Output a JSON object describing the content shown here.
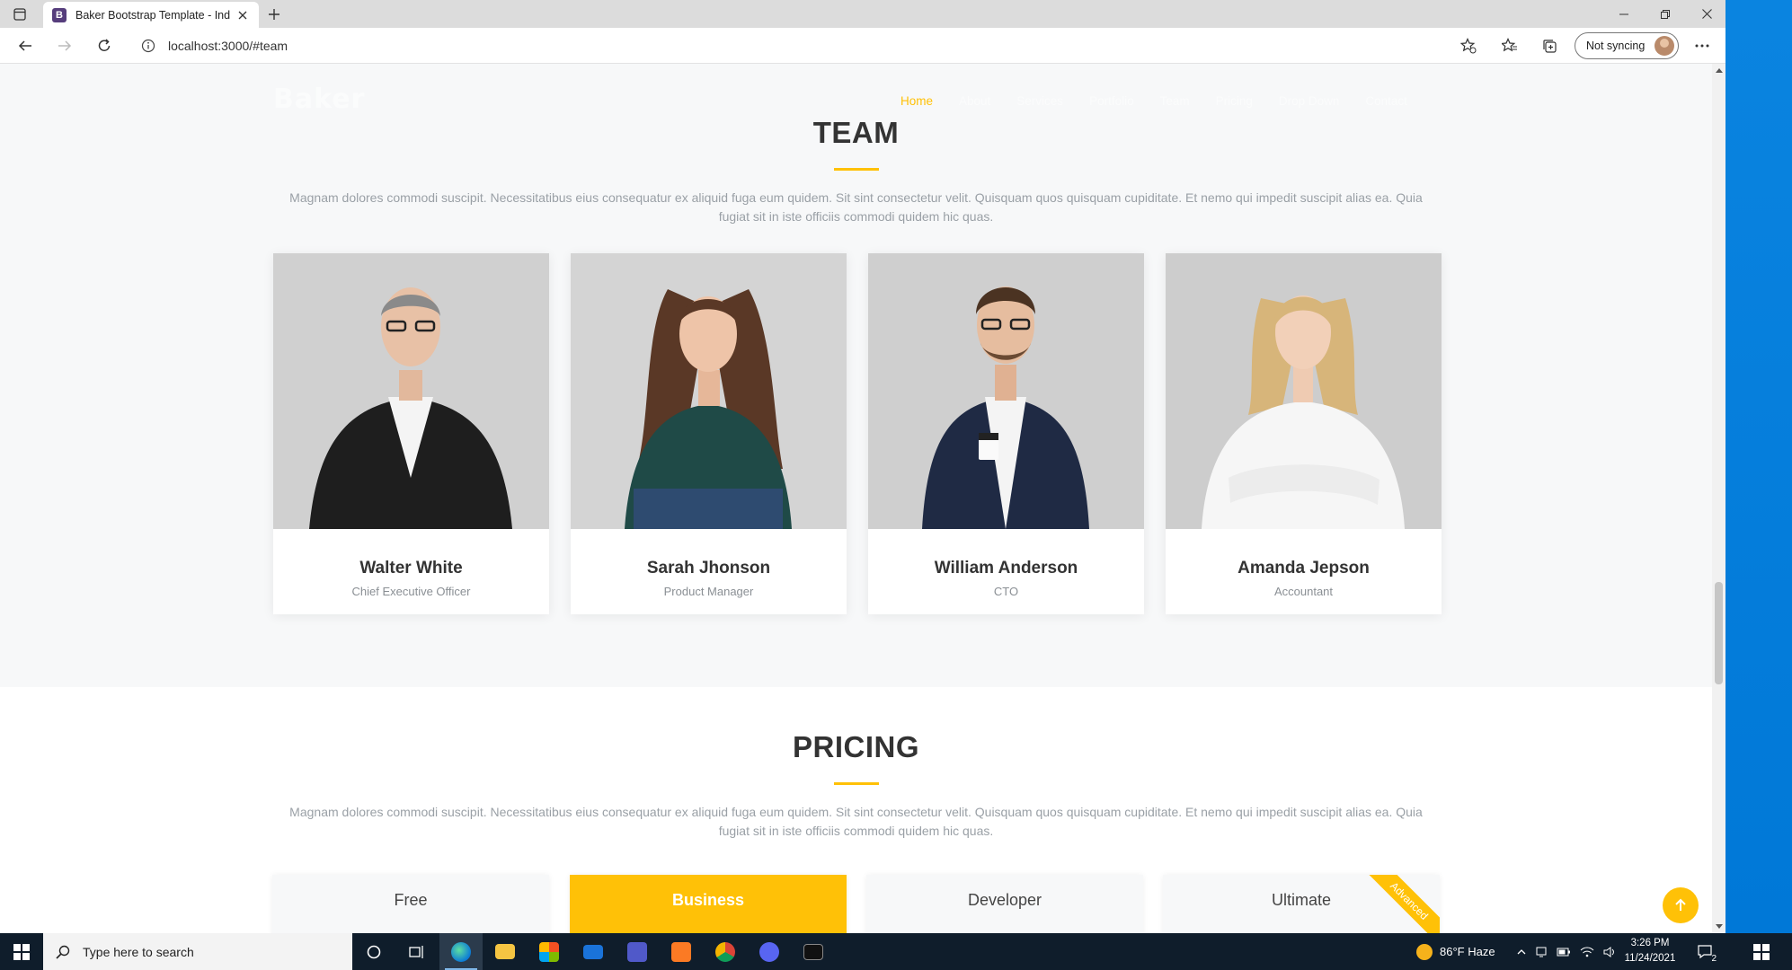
{
  "browser": {
    "tab_title": "Baker Bootstrap Template - Inde",
    "favicon_letter": "B",
    "url": "localhost:3000/#team",
    "sync_label": "Not syncing"
  },
  "site": {
    "logo": "Baker",
    "nav": [
      "Home",
      "About",
      "Services",
      "Portfolio",
      "Team",
      "Pricing",
      "Drop Down",
      "Contact"
    ],
    "active_nav": "Home"
  },
  "team": {
    "title": "TEAM",
    "description": "Magnam dolores commodi suscipit. Necessitatibus eius consequatur ex aliquid fuga eum quidem. Sit sint consectetur velit. Quisquam quos quisquam cupiditate. Et nemo qui impedit suscipit alias ea. Quia fugiat sit in iste officiis commodi quidem hic quas.",
    "members": [
      {
        "name": "Walter White",
        "role": "Chief Executive Officer"
      },
      {
        "name": "Sarah Jhonson",
        "role": "Product Manager"
      },
      {
        "name": "William Anderson",
        "role": "CTO"
      },
      {
        "name": "Amanda Jepson",
        "role": "Accountant"
      }
    ]
  },
  "pricing": {
    "title": "PRICING",
    "description": "Magnam dolores commodi suscipit. Necessitatibus eius consequatur ex aliquid fuga eum quidem. Sit sint consectetur velit. Quisquam quos quisquam cupiditate. Et nemo qui impedit suscipit alias ea. Quia fugiat sit in iste officiis commodi quidem hic quas.",
    "plans": [
      "Free",
      "Business",
      "Developer",
      "Ultimate"
    ],
    "ribbon": "Advanced"
  },
  "taskbar": {
    "search_placeholder": "Type here to search",
    "weather": "86°F  Haze",
    "time": "3:26 PM",
    "date": "11/24/2021",
    "notifications": "2"
  },
  "colors": {
    "accent": "#ffc107",
    "heading": "#333333",
    "muted": "#9aa0a6"
  }
}
